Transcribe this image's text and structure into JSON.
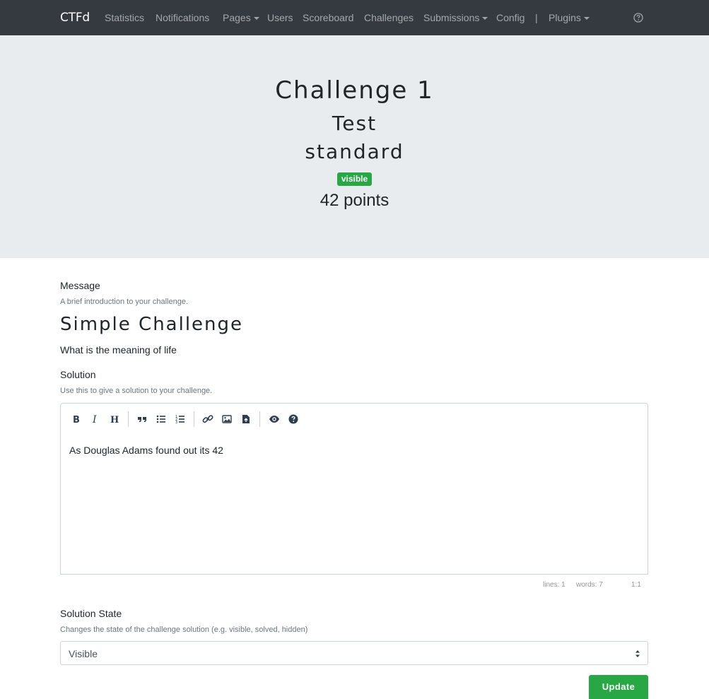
{
  "navbar": {
    "brand": "CTFd",
    "items": [
      {
        "label": "Statistics",
        "dropdown": false
      },
      {
        "label": "Notifications",
        "dropdown": false
      },
      {
        "label": "Pages",
        "dropdown": true
      },
      {
        "label": "Users",
        "dropdown": false
      },
      {
        "label": "Scoreboard",
        "dropdown": false
      },
      {
        "label": "Challenges",
        "dropdown": false
      },
      {
        "label": "Submissions",
        "dropdown": true
      },
      {
        "label": "Config",
        "dropdown": false
      },
      {
        "label": "|",
        "dropdown": false
      },
      {
        "label": "Plugins",
        "dropdown": true
      }
    ],
    "help_icon": "question-circle-icon"
  },
  "challenge": {
    "name": "Challenge 1",
    "category": "Test",
    "type": "standard",
    "state_badge": "visible",
    "points": "42 points"
  },
  "message": {
    "label": "Message",
    "help": "A brief introduction to your challenge.",
    "heading": "Simple Challenge",
    "text": "What is the meaning of life"
  },
  "solution": {
    "label": "Solution",
    "help": "Use this to give a solution to your challenge.",
    "content": "As Douglas Adams found out its 42",
    "toolbar_icons": [
      "bold-icon",
      "italic-icon",
      "heading-icon",
      "quote-icon",
      "unordered-list-icon",
      "ordered-list-icon",
      "link-icon",
      "image-icon",
      "upload-file-icon",
      "preview-icon",
      "guide-icon"
    ],
    "status": {
      "lines": "lines: 1",
      "words": "words: 7",
      "cursor": "1:1"
    }
  },
  "solution_state": {
    "label": "Solution State",
    "help": "Changes the state of the challenge solution (e.g. visible, solved, hidden)",
    "selected": "Visible"
  },
  "actions": {
    "update_label": "Update"
  },
  "colors": {
    "navbar_bg": "#343a40",
    "jumbotron_bg": "#e9ecef",
    "success": "#28a745"
  }
}
